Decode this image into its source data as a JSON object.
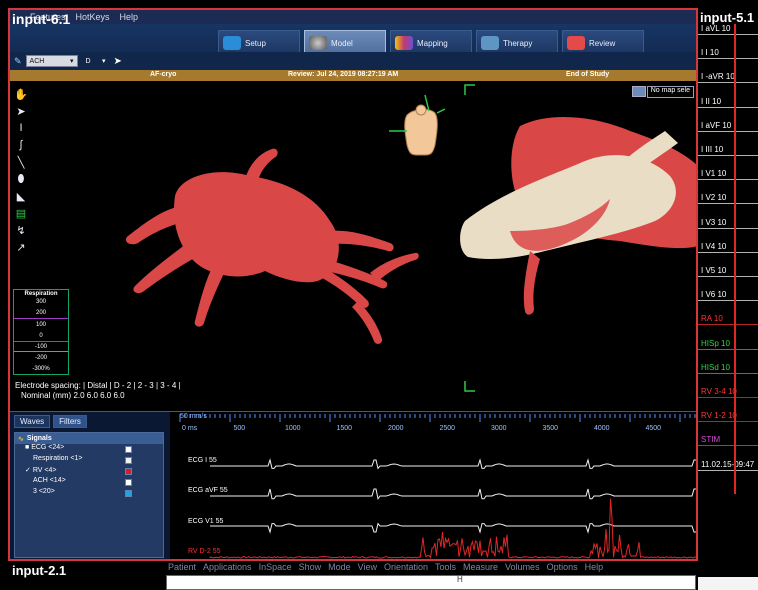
{
  "labels": {
    "main_input": "input-6.1",
    "right_input": "input-5.1",
    "bottom_input": "input-2.1"
  },
  "menubar": [
    "Features",
    "HotKeys",
    "Help"
  ],
  "modes": [
    {
      "label": "Setup",
      "active": false,
      "icon_color": "#2a8dd8"
    },
    {
      "label": "Model",
      "active": true,
      "icon_color": "#7b7b7b"
    },
    {
      "label": "Mapping",
      "active": false,
      "icon_color": "#c23b6f"
    },
    {
      "label": "Therapy",
      "active": false,
      "icon_color": "#5d96c2"
    },
    {
      "label": "Review",
      "active": false,
      "icon_color": "#e44a4a"
    }
  ],
  "subtool": {
    "ach": "ACH",
    "d": "D"
  },
  "status": {
    "left": "AF-cryo",
    "center": "Review: Jul 24, 2019 08:27:19 AM",
    "right": "End of Study"
  },
  "viewer": {
    "no_map": "No map sele",
    "respiration": {
      "title": "Respiration",
      "values": [
        "300",
        "200",
        "100",
        "0",
        "-100",
        "-200",
        "-300%"
      ]
    },
    "electrode": {
      "line1": "Electrode spacing: | Distal | D - 2 | 2 - 3 | 3 - 4 |",
      "line2": "Nominal (mm)       2.0     6.0     6.0     6.0"
    }
  },
  "signals": {
    "tabs": [
      "Waves",
      "Filters"
    ],
    "header": "Signals",
    "rows": [
      {
        "label": "ECG <24>",
        "checked": true,
        "color": "#ffffff"
      },
      {
        "label": "Respiration <1>",
        "checked": false,
        "color": "#f2f2f2"
      },
      {
        "label": "RV <4>",
        "checked": true,
        "color": "#d11f2b"
      },
      {
        "label": "ACH <14>",
        "checked": false,
        "color": "#ffffff"
      },
      {
        "label": "3 <20>",
        "checked": false,
        "color": "#19a6e8"
      }
    ],
    "speed": "50 mm/s",
    "time_ticks": [
      "0 ms",
      "500",
      "1000",
      "1500",
      "2000",
      "2500",
      "3000",
      "3500",
      "4000",
      "4500",
      "500"
    ],
    "trace_labels": [
      "ECG I 55",
      "ECG aVF 55",
      "ECG V1 55",
      "RV  D-2 55"
    ]
  },
  "right_leads": [
    {
      "label": "I aVL  10",
      "color": "#ffffff"
    },
    {
      "label": "I I  10",
      "color": "#ffffff"
    },
    {
      "label": "I -aVR  10",
      "color": "#ffffff"
    },
    {
      "label": "I II  10",
      "color": "#ffffff"
    },
    {
      "label": "I aVF  10",
      "color": "#ffffff"
    },
    {
      "label": "I III  10",
      "color": "#ffffff"
    },
    {
      "label": "I V1  10",
      "color": "#ffffff"
    },
    {
      "label": "I V2  10",
      "color": "#ffffff"
    },
    {
      "label": "I V3  10",
      "color": "#ffffff"
    },
    {
      "label": "I V4  10",
      "color": "#ffffff"
    },
    {
      "label": "I V5  10",
      "color": "#ffffff"
    },
    {
      "label": "I V6  10",
      "color": "#ffffff"
    },
    {
      "label": "RA  10",
      "color": "#ff3333"
    },
    {
      "label": "HISp  10",
      "color": "#38d24a"
    },
    {
      "label": "HISd  10",
      "color": "#38d24a"
    },
    {
      "label": "RV 3-4  10",
      "color": "#ff3333"
    },
    {
      "label": "RV 1-2  10",
      "color": "#ff3333"
    },
    {
      "label": "STIM",
      "color": "#d449d4"
    },
    {
      "label": "11.02.15-09:47",
      "color": "#ffffff"
    }
  ],
  "app_menu": [
    "Patient",
    "Applications",
    "InSpace",
    "Show",
    "Mode",
    "View",
    "Orientation",
    "Tools",
    "Measure",
    "Volumes",
    "Options",
    "Help"
  ],
  "bottom_h": "H"
}
